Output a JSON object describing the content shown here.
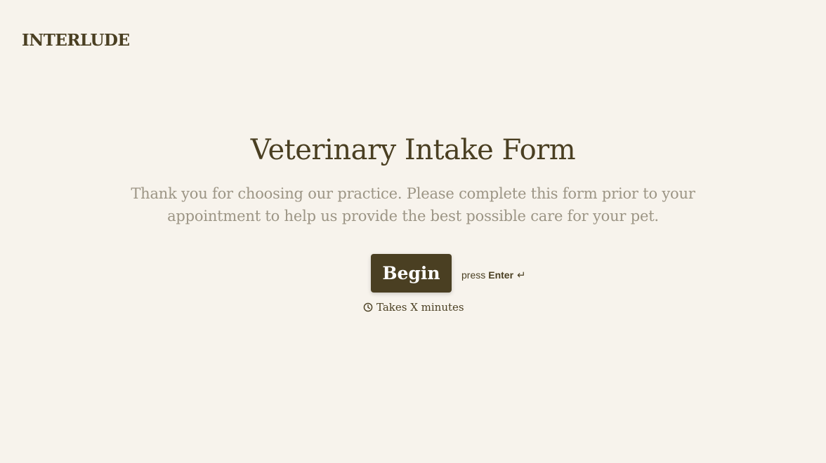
{
  "brand": {
    "name": "INTERLUDE"
  },
  "hero": {
    "title": "Veterinary Intake Form",
    "subtitle": "Thank you for choosing our practice. Please complete this form prior to your appointment to help us provide the best possible care for your pet."
  },
  "actions": {
    "begin_label": "Begin",
    "hint_prefix": "press",
    "hint_key": "Enter",
    "hint_icon": "return-icon",
    "hint_glyph": "↵"
  },
  "duration": {
    "icon": "clock-icon",
    "label": "Takes X minutes"
  },
  "colors": {
    "background": "#f7f3ec",
    "primary": "#4a3f22",
    "muted_text": "#9c9585",
    "button_text": "#ffffff"
  }
}
